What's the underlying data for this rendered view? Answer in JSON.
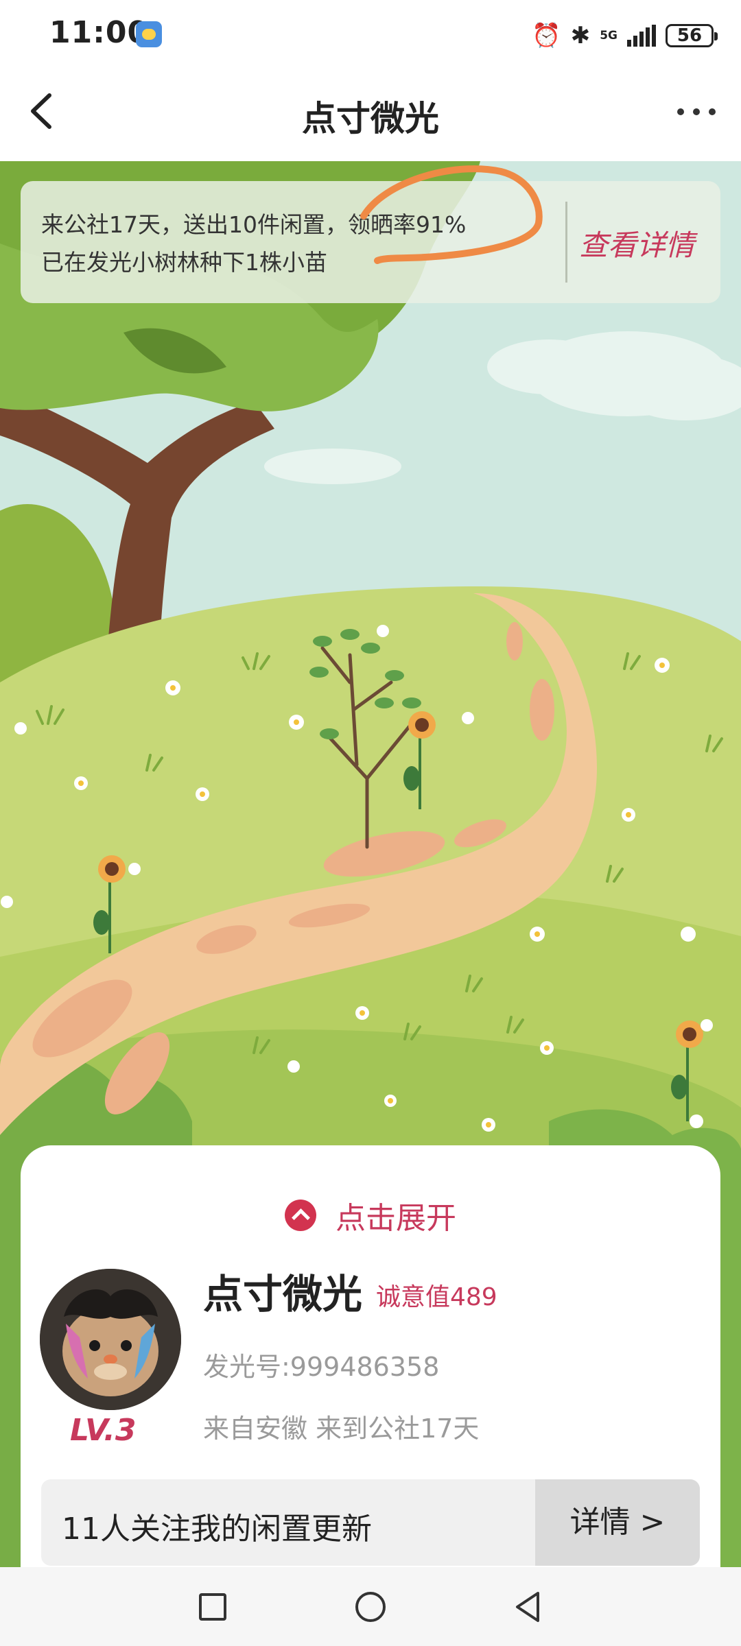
{
  "status_bar": {
    "time": "11:00",
    "network": "5G",
    "battery": "56"
  },
  "nav": {
    "title": "点寸微光"
  },
  "banner": {
    "line1": "来公社17天，送出10件闲置，领晒率91%",
    "line2": "已在发光小树林种下1株小苗",
    "link": "查看详情"
  },
  "card": {
    "expand_label": "点击展开",
    "name": "点寸微光",
    "sincerity": "诚意值489",
    "uid": "发光号:999486358",
    "origin": "来自安徽 来到公社17天",
    "level": "LV.3",
    "follow_text": "11人关注我的闲置更新",
    "follow_button": "详情 >"
  },
  "colors": {
    "accent": "#c7395c",
    "grass": "#a9c95a",
    "path": "#f2c89a",
    "sky": "#cfe8e0"
  }
}
